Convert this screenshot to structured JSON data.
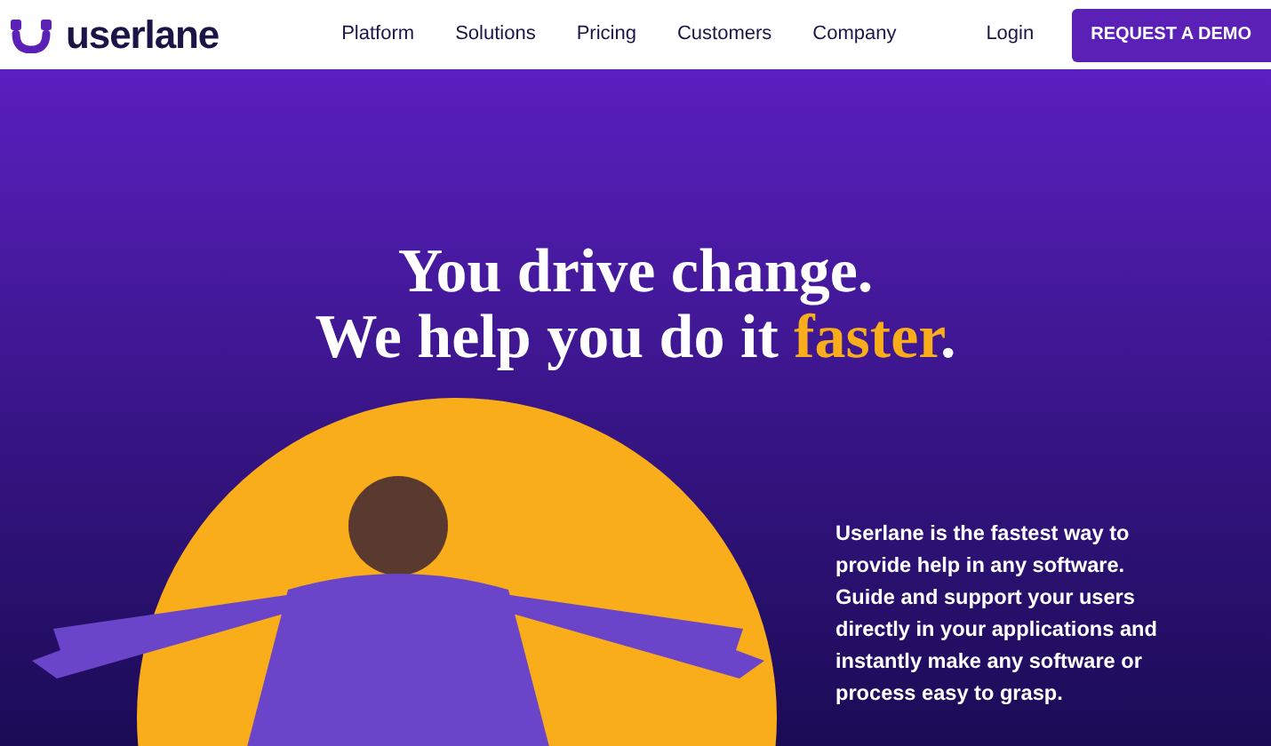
{
  "header": {
    "logo": "userlane",
    "nav": [
      {
        "label": "Platform"
      },
      {
        "label": "Solutions"
      },
      {
        "label": "Pricing"
      },
      {
        "label": "Customers"
      },
      {
        "label": "Company"
      }
    ],
    "login": "Login",
    "cta": "REQUEST A DEMO"
  },
  "hero": {
    "headline": [
      [
        {
          "text": "You drive change.",
          "highlight": false
        }
      ],
      [
        {
          "text": "We help you do it ",
          "highlight": false
        },
        {
          "text": "faster",
          "highlight": true
        },
        {
          "text": ".",
          "highlight": false
        }
      ]
    ],
    "description": "Userlane is the fastest way to provide help in any software. Guide and support your users directly in your applications and instantly make any software or process easy to grasp."
  }
}
